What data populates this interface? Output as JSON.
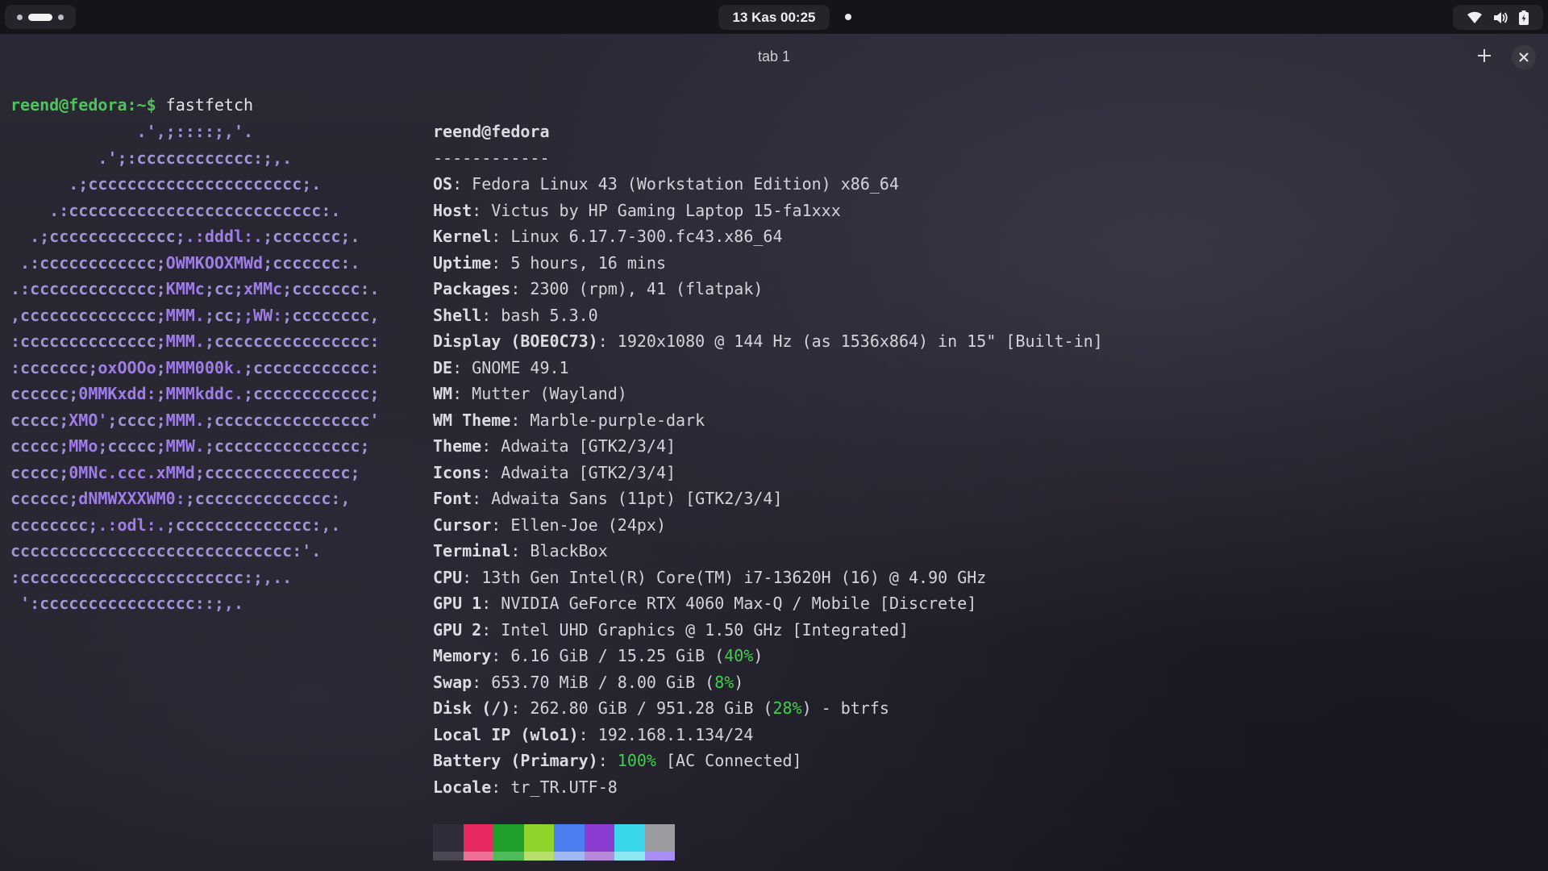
{
  "topbar": {
    "clock": "13 Kas  00:25",
    "icons": [
      "wifi-icon",
      "volume-icon",
      "battery-icon"
    ]
  },
  "header": {
    "tab_title": "tab 1",
    "new_tab_icon": "plus-icon",
    "close_icon": "close-icon"
  },
  "terminal": {
    "prompt": "reend@fedora:~$",
    "command": "fastfetch",
    "logo_lines": [
      [
        [
          "c",
          "             .',;::::;,'."
        ]
      ],
      [
        [
          "c",
          "         .';:cccccccccccc:;,."
        ]
      ],
      [
        [
          "c",
          "      .;cccccccccccccccccccccc;."
        ]
      ],
      [
        [
          "c",
          "    .:cccccccccccccccccccccccccc:."
        ]
      ],
      [
        [
          "c",
          "  .;ccccccccccccc;"
        ],
        [
          "m",
          ".:dddl:."
        ],
        [
          "c",
          ";ccccccc;."
        ]
      ],
      [
        [
          "c",
          " .:cccccccccccc;"
        ],
        [
          "m",
          "OWMKOOXMWd"
        ],
        [
          "c",
          ";ccccccc:."
        ]
      ],
      [
        [
          "c",
          ".:ccccccccccccc;"
        ],
        [
          "m",
          "KMMc"
        ],
        [
          "c",
          ";cc;"
        ],
        [
          "m",
          "xMMc"
        ],
        [
          "c",
          ";ccccccc:."
        ]
      ],
      [
        [
          "c",
          ",cccccccccccccc;"
        ],
        [
          "m",
          "MMM."
        ],
        [
          "c",
          ";cc;"
        ],
        [
          "m",
          ";WW:"
        ],
        [
          "c",
          ";cccccccc,"
        ]
      ],
      [
        [
          "c",
          ":cccccccccccccc;"
        ],
        [
          "m",
          "MMM."
        ],
        [
          "c",
          ";cccccccccccccccc:"
        ]
      ],
      [
        [
          "c",
          ":ccccccc;"
        ],
        [
          "m",
          "oxOOOo"
        ],
        [
          "c",
          ";"
        ],
        [
          "m",
          "MMM000k."
        ],
        [
          "c",
          ";cccccccccccc:"
        ]
      ],
      [
        [
          "c",
          "cccccc;"
        ],
        [
          "m",
          "0MMKxdd:"
        ],
        [
          "c",
          ";"
        ],
        [
          "m",
          "MMMkddc."
        ],
        [
          "c",
          ";cccccccccccc;"
        ]
      ],
      [
        [
          "c",
          "ccccc;"
        ],
        [
          "m",
          "XMO'"
        ],
        [
          "c",
          ";cccc;"
        ],
        [
          "m",
          "MMM."
        ],
        [
          "c",
          ";cccccccccccccccc'"
        ]
      ],
      [
        [
          "c",
          "ccccc;"
        ],
        [
          "m",
          "MMo"
        ],
        [
          "c",
          ";ccccc;"
        ],
        [
          "m",
          "MMW."
        ],
        [
          "c",
          ";ccccccccccccccc;"
        ]
      ],
      [
        [
          "c",
          "ccccc;"
        ],
        [
          "m",
          "0MNc.ccc.xMMd"
        ],
        [
          "c",
          ";ccccccccccccccc;"
        ]
      ],
      [
        [
          "c",
          "cccccc;"
        ],
        [
          "m",
          "dNMWXXXWM0:"
        ],
        [
          "c",
          ";cccccccccccccc:,"
        ]
      ],
      [
        [
          "c",
          "cccccccc;"
        ],
        [
          "m",
          ".:odl:."
        ],
        [
          "c",
          ";cccccccccccccc:,."
        ]
      ],
      [
        [
          "c",
          "ccccccccccccccccccccccccccccc:'."
        ]
      ],
      [
        [
          "c",
          ":ccccccccccccccccccccccc:;,.."
        ]
      ],
      [
        [
          "c",
          " ':cccccccccccccccc::;,."
        ]
      ]
    ],
    "info_lines": [
      {
        "parts": [
          [
            "k",
            "reend@fedora"
          ]
        ]
      },
      {
        "parts": [
          [
            "v",
            "------------"
          ]
        ]
      },
      {
        "parts": [
          [
            "k",
            "OS"
          ],
          [
            "v",
            ": Fedora Linux 43 (Workstation Edition) x86_64"
          ]
        ]
      },
      {
        "parts": [
          [
            "k",
            "Host"
          ],
          [
            "v",
            ": Victus by HP Gaming Laptop 15-fa1xxx"
          ]
        ]
      },
      {
        "parts": [
          [
            "k",
            "Kernel"
          ],
          [
            "v",
            ": Linux 6.17.7-300.fc43.x86_64"
          ]
        ]
      },
      {
        "parts": [
          [
            "k",
            "Uptime"
          ],
          [
            "v",
            ": 5 hours, 16 mins"
          ]
        ]
      },
      {
        "parts": [
          [
            "k",
            "Packages"
          ],
          [
            "v",
            ": 2300 (rpm), 41 (flatpak)"
          ]
        ]
      },
      {
        "parts": [
          [
            "k",
            "Shell"
          ],
          [
            "v",
            ": bash 5.3.0"
          ]
        ]
      },
      {
        "parts": [
          [
            "k",
            "Display (BOE0C73)"
          ],
          [
            "v",
            ": 1920x1080 @ 144 Hz (as 1536x864) in 15\" [Built-in]"
          ]
        ]
      },
      {
        "parts": [
          [
            "k",
            "DE"
          ],
          [
            "v",
            ": GNOME 49.1"
          ]
        ]
      },
      {
        "parts": [
          [
            "k",
            "WM"
          ],
          [
            "v",
            ": Mutter (Wayland)"
          ]
        ]
      },
      {
        "parts": [
          [
            "k",
            "WM Theme"
          ],
          [
            "v",
            ": Marble-purple-dark"
          ]
        ]
      },
      {
        "parts": [
          [
            "k",
            "Theme"
          ],
          [
            "v",
            ": Adwaita [GTK2/3/4]"
          ]
        ]
      },
      {
        "parts": [
          [
            "k",
            "Icons"
          ],
          [
            "v",
            ": Adwaita [GTK2/3/4]"
          ]
        ]
      },
      {
        "parts": [
          [
            "k",
            "Font"
          ],
          [
            "v",
            ": Adwaita Sans (11pt) [GTK2/3/4]"
          ]
        ]
      },
      {
        "parts": [
          [
            "k",
            "Cursor"
          ],
          [
            "v",
            ": Ellen-Joe (24px)"
          ]
        ]
      },
      {
        "parts": [
          [
            "k",
            "Terminal"
          ],
          [
            "v",
            ": BlackBox"
          ]
        ]
      },
      {
        "parts": [
          [
            "k",
            "CPU"
          ],
          [
            "v",
            ": 13th Gen Intel(R) Core(TM) i7-13620H (16) @ 4.90 GHz"
          ]
        ]
      },
      {
        "parts": [
          [
            "k",
            "GPU 1"
          ],
          [
            "v",
            ": NVIDIA GeForce RTX 4060 Max-Q / Mobile [Discrete]"
          ]
        ]
      },
      {
        "parts": [
          [
            "k",
            "GPU 2"
          ],
          [
            "v",
            ": Intel UHD Graphics @ 1.50 GHz [Integrated]"
          ]
        ]
      },
      {
        "parts": [
          [
            "k",
            "Memory"
          ],
          [
            "v",
            ": 6.16 GiB / 15.25 GiB ("
          ],
          [
            "g",
            "40%"
          ],
          [
            "v",
            ")"
          ]
        ]
      },
      {
        "parts": [
          [
            "k",
            "Swap"
          ],
          [
            "v",
            ": 653.70 MiB / 8.00 GiB ("
          ],
          [
            "g",
            "8%"
          ],
          [
            "v",
            ")"
          ]
        ]
      },
      {
        "parts": [
          [
            "k",
            "Disk (/)"
          ],
          [
            "v",
            ": 262.80 GiB / 951.28 GiB ("
          ],
          [
            "g",
            "28%"
          ],
          [
            "v",
            ") - btrfs"
          ]
        ]
      },
      {
        "parts": [
          [
            "k",
            "Local IP (wlo1)"
          ],
          [
            "v",
            ": 192.168.1.134/24"
          ]
        ]
      },
      {
        "parts": [
          [
            "k",
            "Battery (Primary)"
          ],
          [
            "v",
            ": "
          ],
          [
            "g",
            "100%"
          ],
          [
            "v",
            " [AC Connected]"
          ]
        ]
      },
      {
        "parts": [
          [
            "k",
            "Locale"
          ],
          [
            "v",
            ": tr_TR.UTF-8"
          ]
        ]
      }
    ],
    "palette": [
      {
        "top": "#2f2c3b",
        "bottom": "#4b4757"
      },
      {
        "top": "#e8295f",
        "bottom": "#f07095"
      },
      {
        "top": "#1fa02a",
        "bottom": "#4fba59"
      },
      {
        "top": "#8ed42a",
        "bottom": "#b6e06c"
      },
      {
        "top": "#4b7ff0",
        "bottom": "#a2b8f2"
      },
      {
        "top": "#8a3bd0",
        "bottom": "#b68ad8"
      },
      {
        "top": "#38d6e8",
        "bottom": "#8be8f2"
      },
      {
        "top": "#9c9ba0",
        "bottom": "#a88ef0"
      }
    ]
  }
}
